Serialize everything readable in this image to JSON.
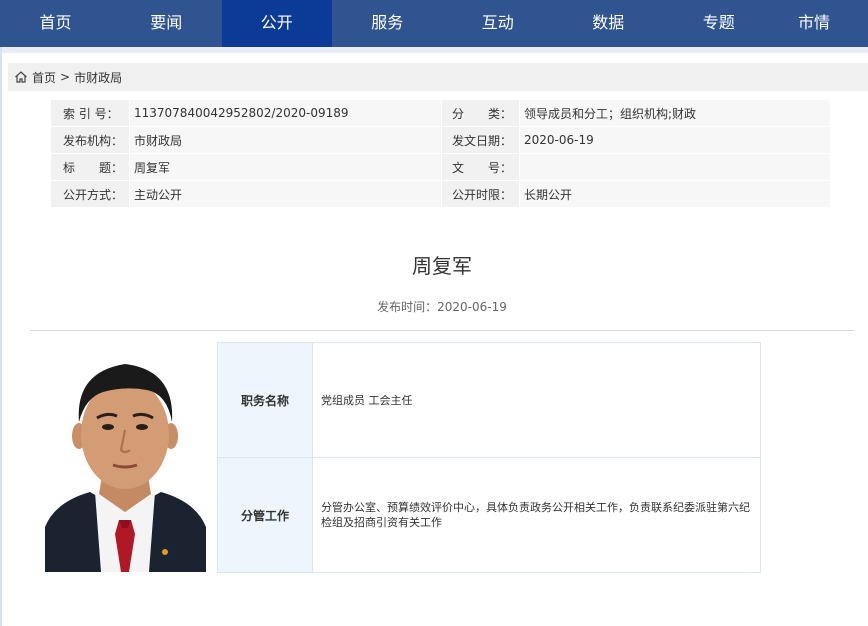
{
  "nav": {
    "items": [
      {
        "label": "首页"
      },
      {
        "label": "要闻"
      },
      {
        "label": "公开"
      },
      {
        "label": "服务"
      },
      {
        "label": "互动"
      },
      {
        "label": "数据"
      },
      {
        "label": "专题"
      },
      {
        "label": "市情"
      }
    ],
    "active_index": 2,
    "bar_color": "#30548f",
    "active_color": "#0b3b96"
  },
  "breadcrumb": {
    "home": "首页",
    "separator": ">",
    "current": "市财政局"
  },
  "meta": {
    "index_label": "索 引 号：",
    "index_value": "113707840042952802/2020-09189",
    "category_label": "分　　类：",
    "category_value": "领导成员和分工；组织机构;财政",
    "org_label": "发布机构：",
    "org_value": "市财政局",
    "date_label": "发文日期：",
    "date_value": "2020-06-19",
    "title_label": "标　　题：",
    "title_value": "周复军",
    "docno_label": "文　　号：",
    "docno_value": "",
    "method_label": "公开方式：",
    "method_value": "主动公开",
    "period_label": "公开时限：",
    "period_value": "长期公开"
  },
  "article": {
    "title": "周复军",
    "publish_prefix": "发布时间：",
    "publish_date": "2020-06-19"
  },
  "profile": {
    "position_label": "职务名称",
    "position_value": "党组成员 工会主任",
    "duty_label": "分管工作",
    "duty_value": "分管办公室、预算绩效评价中心，具体负责政务公开相关工作，负责联系纪委派驻第六纪检组及招商引资有关工作"
  }
}
